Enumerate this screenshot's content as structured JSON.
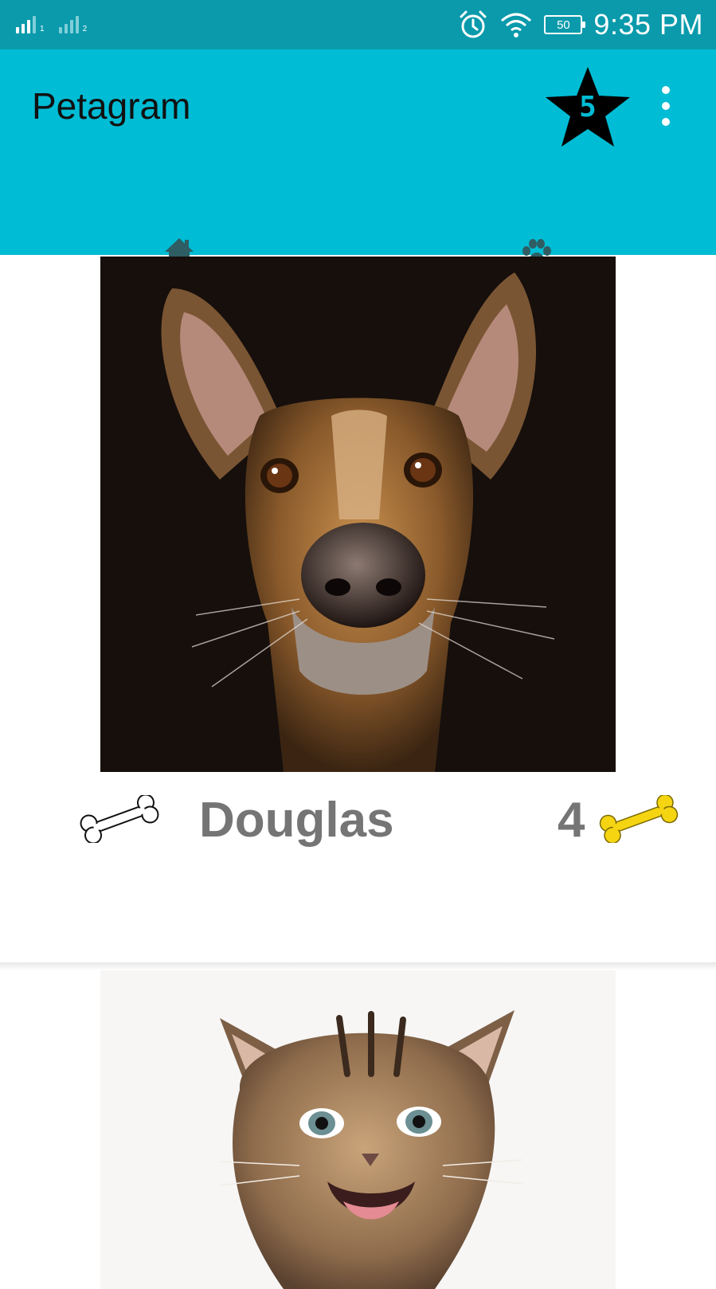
{
  "status_bar": {
    "sim1_label": "1",
    "sim2_label": "2",
    "battery_level": "50",
    "time": "9:35 PM",
    "icons": [
      "signal-icon",
      "signal-icon",
      "alarm-icon",
      "wifi-icon",
      "battery-icon"
    ]
  },
  "app_bar": {
    "title": "Petagram",
    "favorites_count": "5",
    "star_icon": "star-icon",
    "menu_icon": "overflow-menu-icon"
  },
  "tabs": [
    {
      "icon": "home-icon",
      "selected": true
    },
    {
      "icon": "paw-icon",
      "selected": false
    }
  ],
  "colors": {
    "status_bar": "#0a9aab",
    "app_bar": "#00bcd4",
    "tab_indicator": "#f05a51",
    "name_text": "#757575",
    "rating_bone": "#f5d412"
  },
  "pets": [
    {
      "name": "Douglas",
      "likes": "4",
      "photo_icon": "dog-photo",
      "like_icon": "bone-outline-icon",
      "rating_icon": "bone-filled-icon"
    },
    {
      "photo_icon": "cat-photo"
    }
  ]
}
